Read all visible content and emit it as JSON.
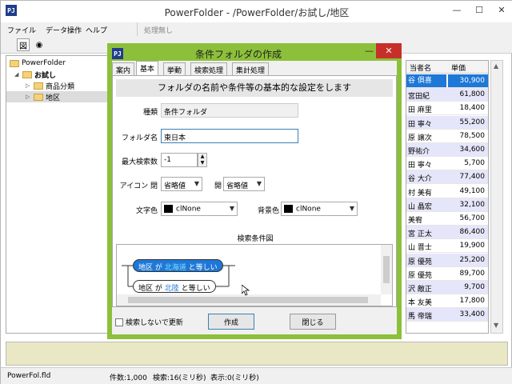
{
  "main_window": {
    "title": "PowerFolder - /PowerFolder/お試し/地区",
    "app_icon": "PJ",
    "controls": {
      "minimize": "—",
      "maximize": "☐",
      "close": "✕"
    }
  },
  "menu": {
    "items": [
      "ファイル",
      "データ操作",
      "ヘルプ"
    ],
    "toolbar_status": "処理無し"
  },
  "toolbar2": {
    "btn1": "図",
    "btn2": "◉"
  },
  "tree": {
    "items": [
      {
        "label": "PowerFolder",
        "level": 0,
        "expander": ""
      },
      {
        "label": "お試し",
        "level": 1,
        "expander": "◢"
      },
      {
        "label": "商品分類",
        "level": 2,
        "expander": "▷"
      },
      {
        "label": "地区",
        "level": 2,
        "expander": "▷"
      }
    ]
  },
  "table": {
    "headers": [
      "当者名",
      "単価"
    ],
    "rows": [
      {
        "name": "谷 俱喜",
        "price": "30,900"
      },
      {
        "name": "宮田紀",
        "price": "61,800"
      },
      {
        "name": "田 麻里",
        "price": "18,400"
      },
      {
        "name": "田 寧々",
        "price": "55,200"
      },
      {
        "name": "原 譲次",
        "price": "78,500"
      },
      {
        "name": "野祐介",
        "price": "34,600"
      },
      {
        "name": "田 寧々",
        "price": "5,700"
      },
      {
        "name": "谷 大介",
        "price": "77,400"
      },
      {
        "name": "村 美有",
        "price": "49,100"
      },
      {
        "name": "山 晶宏",
        "price": "32,100"
      },
      {
        "name": "美宥",
        "price": "56,700"
      },
      {
        "name": "宮 正太",
        "price": "86,400"
      },
      {
        "name": "山 晋士",
        "price": "19,900"
      },
      {
        "name": "原 優苑",
        "price": "25,200"
      },
      {
        "name": "原 優苑",
        "price": "89,700"
      },
      {
        "name": "沢 敵正",
        "price": "9,700"
      },
      {
        "name": "本 友美",
        "price": "17,800"
      },
      {
        "name": "馬 帝瑞",
        "price": "33,400"
      }
    ]
  },
  "statusbar": {
    "file": "PowerFol.fld",
    "count": "件数:1,000",
    "search": "検索:16(ミリ秒)",
    "display": "表示:0(ミリ秒)"
  },
  "dialog": {
    "title": "条件フォルダの作成",
    "tabs": [
      "案内",
      "基本",
      "挙動",
      "検索処理",
      "集計処理"
    ],
    "description": "フォルダの名前や条件等の基本的な設定をします",
    "type_label": "種類",
    "type_value": "条件フォルダ",
    "folder_name_label": "フォルダ名",
    "folder_name_value": "東日本",
    "max_search_label": "最大検索数",
    "max_search_value": "-1",
    "icon_label": "アイコン 閉",
    "icon_closed": "省略値",
    "icon_open_label": "開",
    "icon_open": "省略値",
    "text_color_label": "文字色",
    "text_color": "clNone",
    "bg_color_label": "背景色",
    "bg_color": "clNone",
    "diagram_label": "検索条件図",
    "conditions": [
      {
        "field": "地区",
        "op": "が",
        "value": "北海道",
        "suffix": "と等しい",
        "selected": true
      },
      {
        "field": "地区",
        "op": "が",
        "value": "北陸",
        "suffix": "と等しい",
        "selected": false
      }
    ],
    "checkbox_label": "検索しないで更新",
    "create_button": "作成",
    "close_button": "閉じる"
  }
}
